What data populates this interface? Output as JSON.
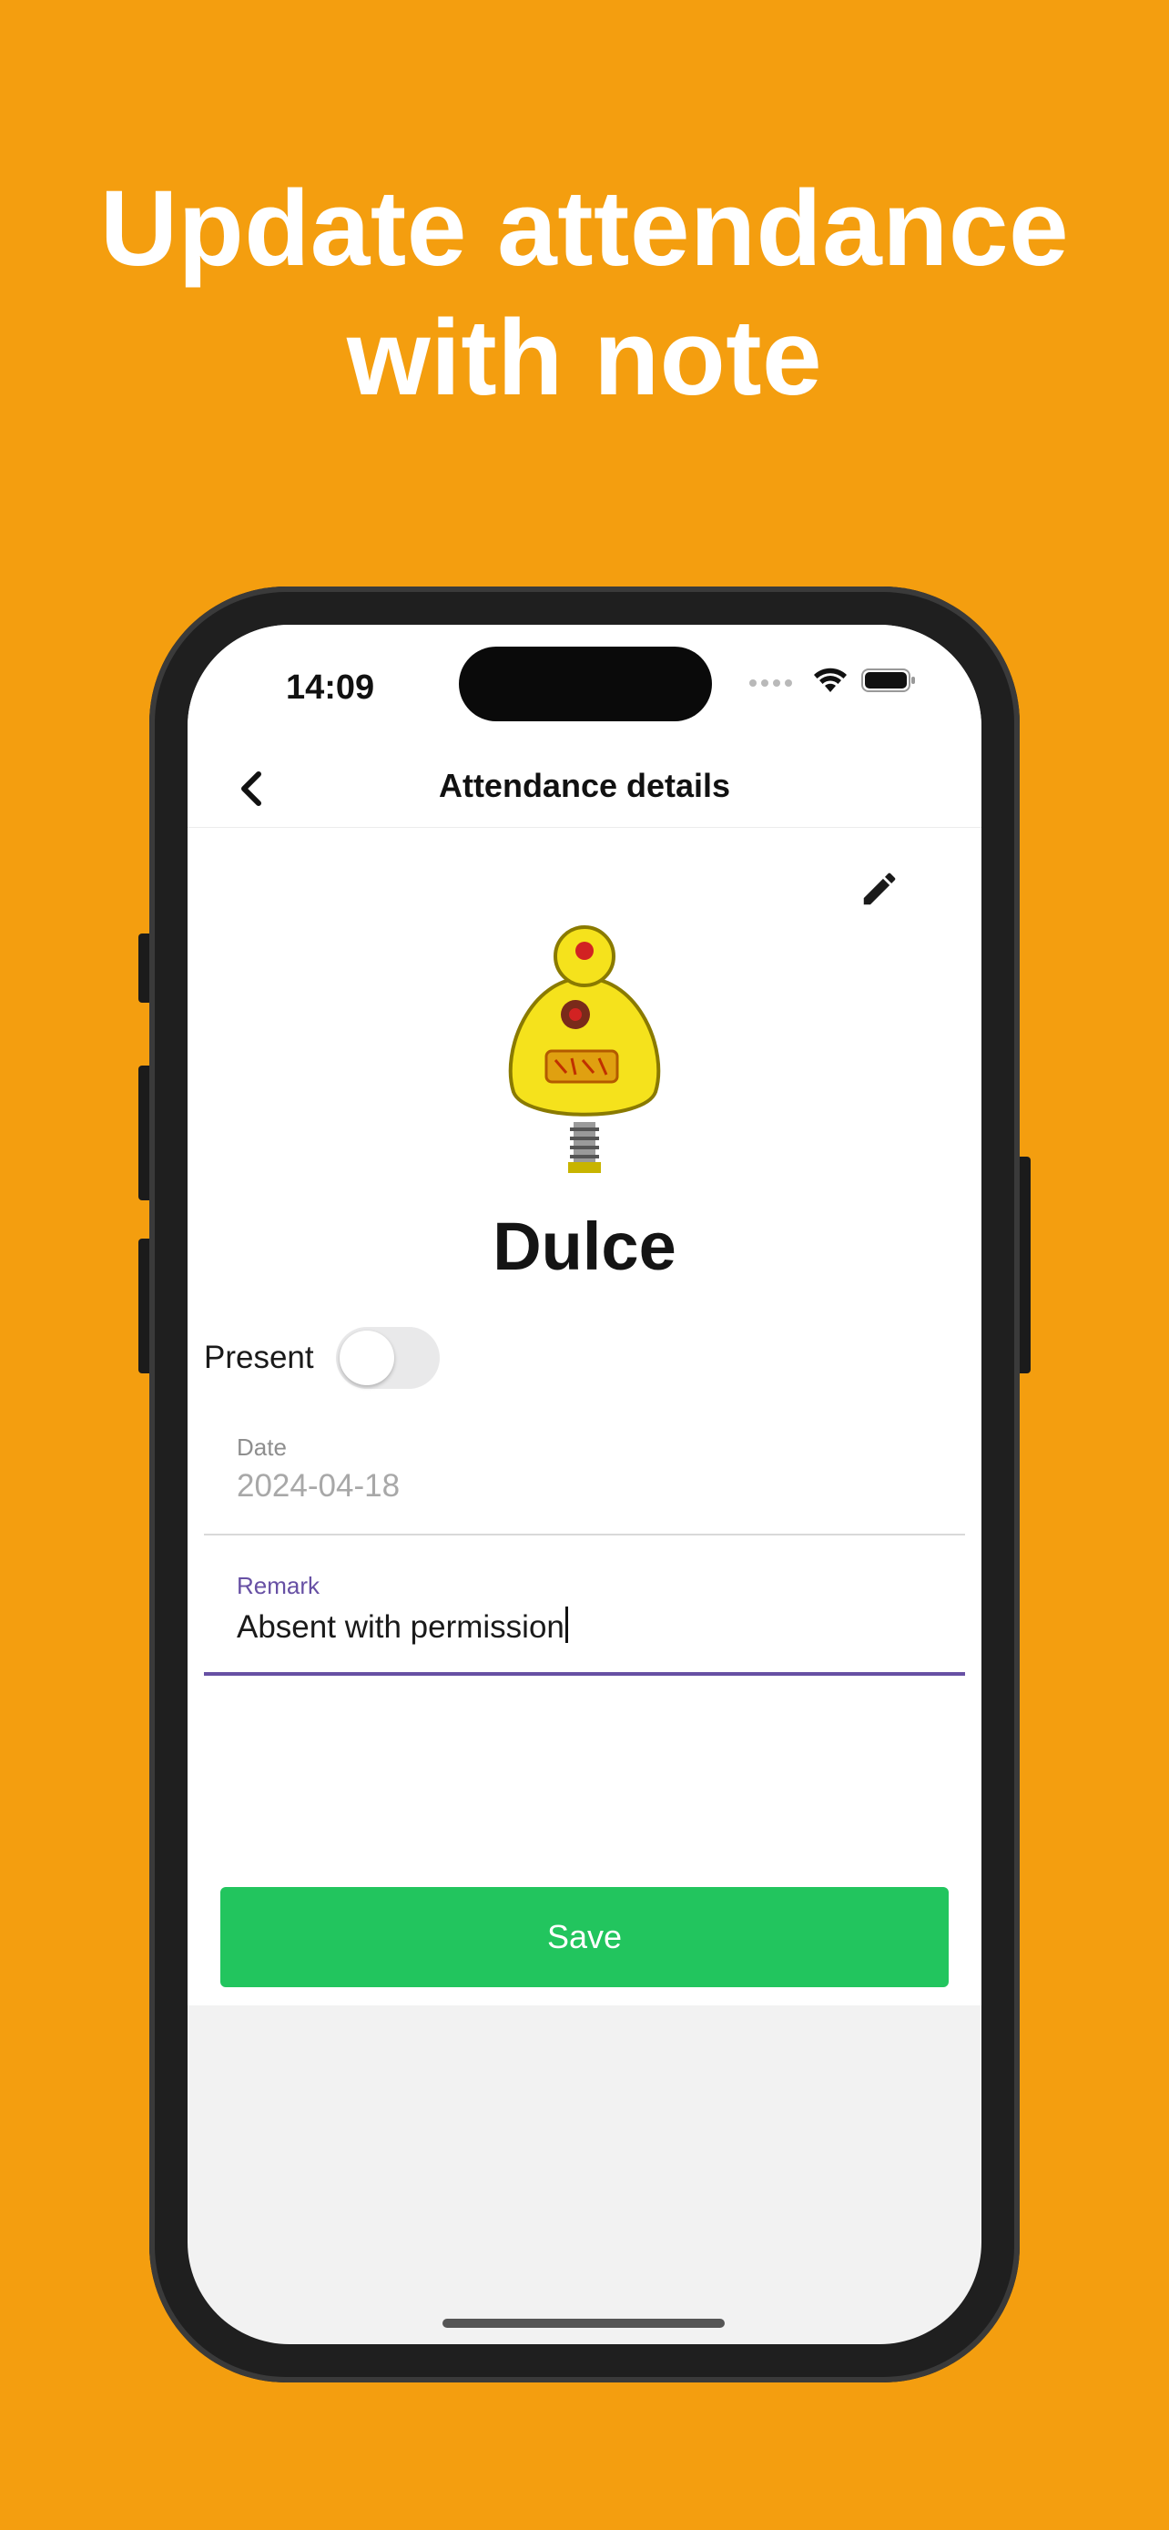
{
  "headline": {
    "line1": "Update attendance",
    "line2": "with note"
  },
  "status_bar": {
    "time": "14:09",
    "icons": [
      "cellular-signal-icon",
      "wifi-icon",
      "battery-icon"
    ]
  },
  "nav": {
    "title": "Attendance details",
    "back_icon": "chevron-left-icon"
  },
  "edit_icon": "pencil-icon",
  "student": {
    "name": "Dulce",
    "avatar": "yellow-robot-avatar"
  },
  "present": {
    "label": "Present",
    "toggle_on": false
  },
  "date_field": {
    "label": "Date",
    "value": "2024-04-18"
  },
  "remark_field": {
    "label": "Remark",
    "value": "Absent with permission"
  },
  "save_label": "Save",
  "colors": {
    "background": "#F49E0F",
    "accent": "#6750A4",
    "save": "#22C55E"
  }
}
